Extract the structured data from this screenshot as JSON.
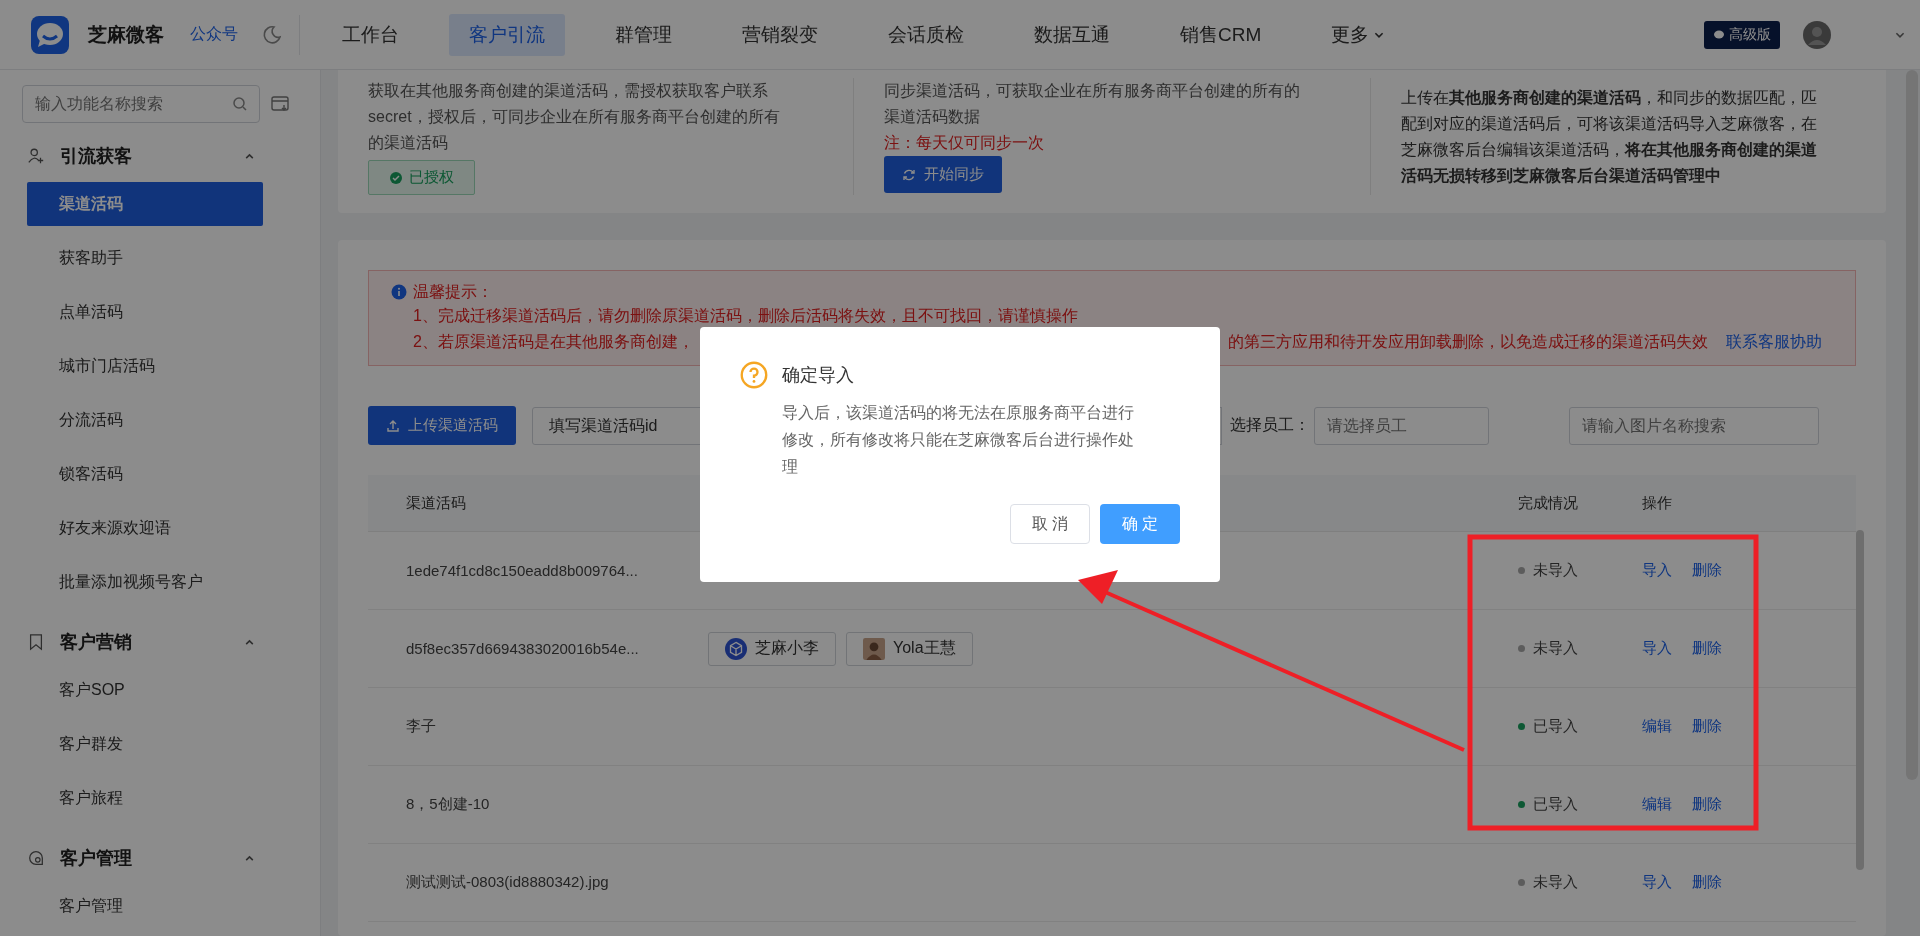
{
  "header": {
    "logo_text": "芝麻微客",
    "account_link": "公众号",
    "nav": [
      {
        "label": "工作台",
        "selected": false
      },
      {
        "label": "客户引流",
        "selected": true
      },
      {
        "label": "群管理",
        "selected": false
      },
      {
        "label": "营销裂变",
        "selected": false
      },
      {
        "label": "会话质检",
        "selected": false
      },
      {
        "label": "数据互通",
        "selected": false
      },
      {
        "label": "销售CRM",
        "selected": false
      }
    ],
    "more": "更多",
    "plan_badge": "高级版"
  },
  "sidebar": {
    "search": {
      "placeholder": "输入功能名称搜索"
    },
    "groups": [
      {
        "title": "引流获客",
        "expanded": true,
        "items": [
          {
            "label": "渠道活码",
            "selected": true
          },
          {
            "label": "获客助手",
            "selected": false
          },
          {
            "label": "点单活码",
            "selected": false
          },
          {
            "label": "城市门店活码",
            "selected": false
          },
          {
            "label": "分流活码",
            "selected": false
          },
          {
            "label": "锁客活码",
            "selected": false
          },
          {
            "label": "好友来源欢迎语",
            "selected": false
          },
          {
            "label": "批量添加视频号客户",
            "selected": false
          }
        ]
      },
      {
        "title": "客户营销",
        "expanded": true,
        "items": [
          {
            "label": "客户SOP",
            "selected": false
          },
          {
            "label": "客户群发",
            "selected": false
          },
          {
            "label": "客户旅程",
            "selected": false
          }
        ]
      },
      {
        "title": "客户管理",
        "expanded": true,
        "items": [
          {
            "label": "客户管理",
            "selected": false
          }
        ]
      }
    ]
  },
  "sync_panels": [
    {
      "kind": "authorize",
      "description": "获取在其他服务商创建的渠道活码，需授权获取客户联系secret，授权后，可同步企业在所有服务商平台创建的所有的渠道活码",
      "button": "已授权"
    },
    {
      "kind": "sync",
      "description": "同步渠道活码，可获取企业在所有服务商平台创建的所有的渠道活码数据",
      "note": "注：每天仅可同步一次",
      "button": "开始同步"
    },
    {
      "kind": "info",
      "description": "上传在**其他服务商创建的渠道活码**，和同步的数据匹配，匹配到对应的渠道活码后，可将该渠道活码导入芝麻微客，在芝麻微客后台编辑该渠道活码，**将在其他服务商创建的渠道活码无损转移到芝麻微客后台渠道活码管理中**"
    }
  ],
  "notice": {
    "title": "温馨提示：",
    "line_1": "1、完成迁移渠道活码后，请勿删除原渠道活码，删除后活码将失效，且不可找回，请谨慎操作",
    "line_2_start": "2、若原渠道活码是在其他服务商创建，",
    "line_2_end": "的第三方应用和待开发应用卸载删除，以免造成迁移的渠道活码失效",
    "link": "联系客服协助"
  },
  "toolbar": {
    "upload_button": "上传渠道活码",
    "id_select": {
      "value": "填写渠道活码id"
    },
    "staff_label": "选择员工：",
    "staff_field": {
      "placeholder": "请选择员工"
    },
    "image_search": {
      "placeholder": "请输入图片名称搜索"
    }
  },
  "table": {
    "columns": [
      "渠道活码",
      "完成情况",
      "操作"
    ],
    "rows": [
      {
        "code": "1ede74f1cd8c150eadd8b009764...",
        "tags": [],
        "imported": false,
        "status": "未导入",
        "actions": [
          "导入",
          "删除"
        ]
      },
      {
        "code": "d5f8ec357d6694383020016b54e...",
        "tags": [
          {
            "label": "芝麻小李",
            "kind": "logo"
          },
          {
            "label": "Yola王慧",
            "kind": "photo"
          }
        ],
        "imported": false,
        "status": "未导入",
        "actions": [
          "导入",
          "删除"
        ]
      },
      {
        "code": "李子",
        "tags": [],
        "imported": true,
        "status": "已导入",
        "actions": [
          "编辑",
          "删除"
        ]
      },
      {
        "code": "8，5创建-10",
        "tags": [],
        "imported": true,
        "status": "已导入",
        "actions": [
          "编辑",
          "删除"
        ]
      },
      {
        "code": "测试测试-0803(id8880342).jpg",
        "tags": [],
        "imported": false,
        "status": "未导入",
        "actions": [
          "导入",
          "删除"
        ]
      }
    ]
  },
  "dialog": {
    "title": "确定导入",
    "message": "导入后，该渠道活码的将无法在原服务商平台进行修改，所有修改将只能在芝麻微客后台进行操作处理",
    "cancel": "取 消",
    "confirm": "确 定"
  }
}
